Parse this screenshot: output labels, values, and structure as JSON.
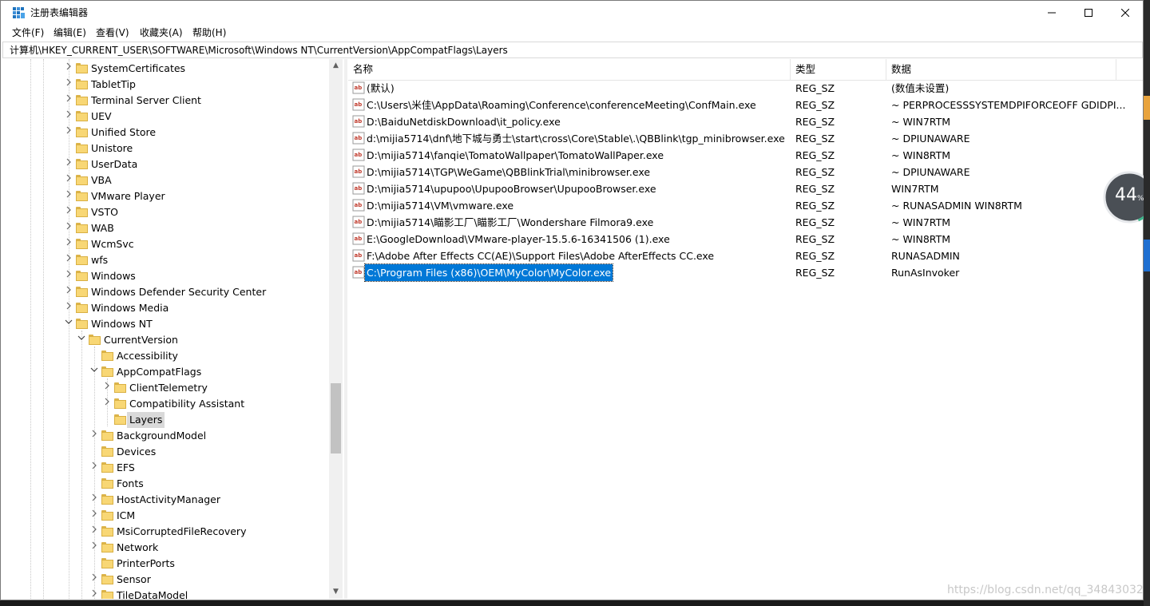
{
  "window": {
    "title": "注册表编辑器"
  },
  "menu": [
    "文件(F)",
    "编辑(E)",
    "查看(V)",
    "收藏夹(A)",
    "帮助(H)"
  ],
  "address": "计算机\\HKEY_CURRENT_USER\\SOFTWARE\\Microsoft\\Windows NT\\CurrentVersion\\AppCompatFlags\\Layers",
  "tree": [
    {
      "label": "SystemCertificates",
      "depth": 0,
      "state": "collapsed"
    },
    {
      "label": "TabletTip",
      "depth": 0,
      "state": "collapsed"
    },
    {
      "label": "Terminal Server Client",
      "depth": 0,
      "state": "collapsed"
    },
    {
      "label": "UEV",
      "depth": 0,
      "state": "collapsed"
    },
    {
      "label": "Unified Store",
      "depth": 0,
      "state": "collapsed"
    },
    {
      "label": "Unistore",
      "depth": 0,
      "state": "leaf"
    },
    {
      "label": "UserData",
      "depth": 0,
      "state": "collapsed"
    },
    {
      "label": "VBA",
      "depth": 0,
      "state": "collapsed"
    },
    {
      "label": "VMware Player",
      "depth": 0,
      "state": "collapsed"
    },
    {
      "label": "VSTO",
      "depth": 0,
      "state": "collapsed"
    },
    {
      "label": "WAB",
      "depth": 0,
      "state": "collapsed"
    },
    {
      "label": "WcmSvc",
      "depth": 0,
      "state": "collapsed"
    },
    {
      "label": "wfs",
      "depth": 0,
      "state": "collapsed"
    },
    {
      "label": "Windows",
      "depth": 0,
      "state": "collapsed"
    },
    {
      "label": "Windows Defender Security Center",
      "depth": 0,
      "state": "collapsed"
    },
    {
      "label": "Windows Media",
      "depth": 0,
      "state": "collapsed"
    },
    {
      "label": "Windows NT",
      "depth": 0,
      "state": "expanded"
    },
    {
      "label": "CurrentVersion",
      "depth": 1,
      "state": "expanded"
    },
    {
      "label": "Accessibility",
      "depth": 2,
      "state": "leaf"
    },
    {
      "label": "AppCompatFlags",
      "depth": 2,
      "state": "expanded"
    },
    {
      "label": "ClientTelemetry",
      "depth": 3,
      "state": "collapsed"
    },
    {
      "label": "Compatibility Assistant",
      "depth": 3,
      "state": "collapsed"
    },
    {
      "label": "Layers",
      "depth": 3,
      "state": "leaf",
      "selected": true
    },
    {
      "label": "BackgroundModel",
      "depth": 2,
      "state": "collapsed"
    },
    {
      "label": "Devices",
      "depth": 2,
      "state": "leaf"
    },
    {
      "label": "EFS",
      "depth": 2,
      "state": "collapsed"
    },
    {
      "label": "Fonts",
      "depth": 2,
      "state": "leaf"
    },
    {
      "label": "HostActivityManager",
      "depth": 2,
      "state": "collapsed"
    },
    {
      "label": "ICM",
      "depth": 2,
      "state": "collapsed"
    },
    {
      "label": "MsiCorruptedFileRecovery",
      "depth": 2,
      "state": "collapsed"
    },
    {
      "label": "Network",
      "depth": 2,
      "state": "collapsed"
    },
    {
      "label": "PrinterPorts",
      "depth": 2,
      "state": "leaf"
    },
    {
      "label": "Sensor",
      "depth": 2,
      "state": "collapsed"
    },
    {
      "label": "TileDataModel",
      "depth": 2,
      "state": "collapsed"
    }
  ],
  "columns": {
    "name": "名称",
    "type": "类型",
    "data": "数据"
  },
  "values": [
    {
      "name": "(默认)",
      "type": "REG_SZ",
      "data": "(数值未设置)"
    },
    {
      "name": "C:\\Users\\米佳\\AppData\\Roaming\\Conference\\conferenceMeeting\\ConfMain.exe",
      "type": "REG_SZ",
      "data": "~ PERPROCESSSYSTEMDPIFORCEOFF GDIDPI..."
    },
    {
      "name": "D:\\BaiduNetdiskDownload\\it_policy.exe",
      "type": "REG_SZ",
      "data": "~ WIN7RTM"
    },
    {
      "name": "d:\\mijia5714\\dnf\\地下城与勇士\\start\\cross\\Core\\Stable\\.\\QBBlink\\tgp_minibrowser.exe",
      "type": "REG_SZ",
      "data": "~ DPIUNAWARE"
    },
    {
      "name": "D:\\mijia5714\\fanqie\\TomatoWallpaper\\TomatoWallPaper.exe",
      "type": "REG_SZ",
      "data": "~ WIN8RTM"
    },
    {
      "name": "D:\\mijia5714\\TGP\\WeGame\\QBBlinkTrial\\minibrowser.exe",
      "type": "REG_SZ",
      "data": "~ DPIUNAWARE"
    },
    {
      "name": "D:\\mijia5714\\upupoo\\UpupooBrowser\\UpupooBrowser.exe",
      "type": "REG_SZ",
      "data": "WIN7RTM"
    },
    {
      "name": "D:\\mijia5714\\VM\\vmware.exe",
      "type": "REG_SZ",
      "data": "~ RUNASADMIN WIN8RTM"
    },
    {
      "name": "D:\\mijia5714\\瞄影工厂\\瞄影工厂\\Wondershare Filmora9.exe",
      "type": "REG_SZ",
      "data": "~ WIN7RTM"
    },
    {
      "name": "E:\\GoogleDownload\\VMware-player-15.5.6-16341506 (1).exe",
      "type": "REG_SZ",
      "data": "~ WIN8RTM"
    },
    {
      "name": "F:\\Adobe After Effects CC(AE)\\Support Files\\Adobe AfterEffects CC.exe",
      "type": "REG_SZ",
      "data": "RUNASADMIN"
    },
    {
      "name": "C:\\Program Files (x86)\\OEM\\MyColor\\MyColor.exe",
      "type": "REG_SZ",
      "data": "RunAsInvoker",
      "selected": true
    }
  ],
  "speed_widget": {
    "value": "44",
    "unit": "%"
  },
  "watermark": "https://blog.csdn.net/qq_34843032",
  "colors": {
    "selection": "#0078d7",
    "folder": "#f8d775",
    "accent_strip": "#e8a33d"
  }
}
